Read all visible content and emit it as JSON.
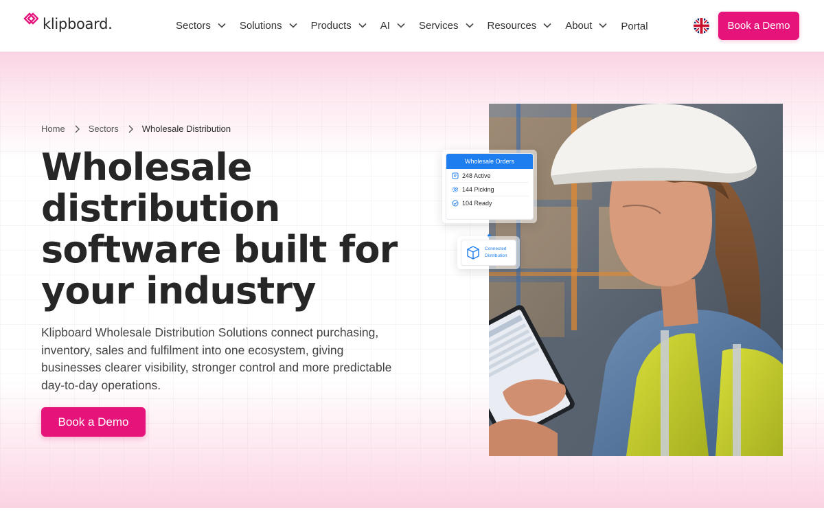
{
  "header": {
    "logo_text": "klipboard.",
    "nav": [
      {
        "label": "Sectors"
      },
      {
        "label": "Solutions"
      },
      {
        "label": "Products"
      },
      {
        "label": "AI"
      },
      {
        "label": "Services"
      },
      {
        "label": "Resources"
      },
      {
        "label": "About"
      }
    ],
    "portal_label": "Portal",
    "cta_label": "Book a Demo"
  },
  "breadcrumb": {
    "home": "Home",
    "sectors": "Sectors",
    "current": "Wholesale Distribution"
  },
  "hero": {
    "title_lines": [
      "Wholesale",
      "distribution",
      "software built for",
      "your industry"
    ],
    "description": "Klipboard Wholesale Distribution Solutions connect purchasing, inventory, sales and fulfilment into one ecosystem, giving businesses clearer visibility, stronger control and more predictable day-to-day operations.",
    "cta_label": "Book a Demo"
  },
  "orders_card": {
    "title": "Wholesale Orders",
    "rows": [
      {
        "icon": "list-icon",
        "text": "248 Active"
      },
      {
        "icon": "gear-icon",
        "text": "144 Picking"
      },
      {
        "icon": "check-circle-icon",
        "text": "104 Ready"
      }
    ]
  },
  "connected_card": {
    "line1": "Connected",
    "line2": "Distribution",
    "icon": "box-icon"
  },
  "colors": {
    "brand_pink": "#e6137a",
    "accent_blue": "#1e7ef0",
    "text_dark": "#262626"
  }
}
